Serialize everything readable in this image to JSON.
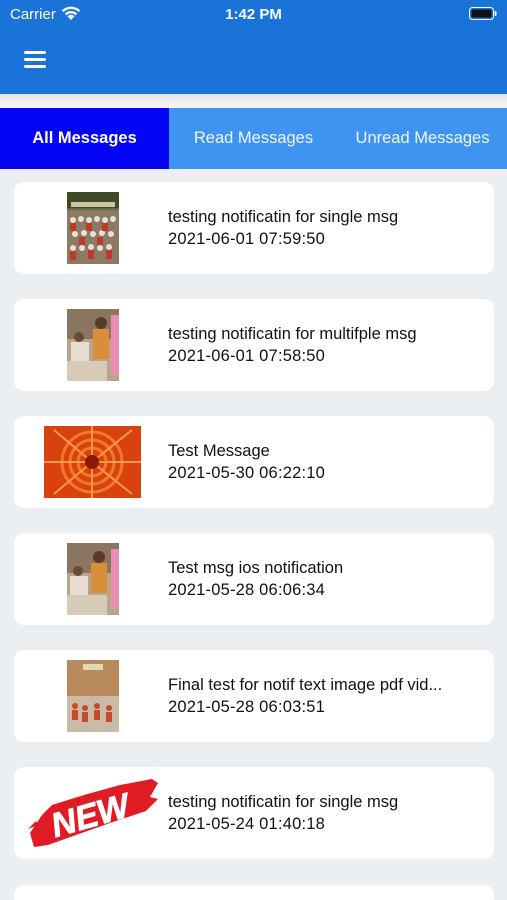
{
  "status_bar": {
    "carrier": "Carrier",
    "time": "1:42 PM"
  },
  "header": {
    "menu_icon": "hamburger-menu-icon",
    "color": "#1a73d9"
  },
  "tabs": [
    {
      "label": "All Messages",
      "active": true
    },
    {
      "label": "Read Messages",
      "active": false
    },
    {
      "label": "Unread Messages",
      "active": false
    }
  ],
  "messages": [
    {
      "title": "testing notificatin for single msg",
      "date": "2021-06-01 07:59:50",
      "thumbnail": "group-photo"
    },
    {
      "title": "testing notificatin for multifple msg",
      "date": "2021-06-01 07:58:50",
      "thumbnail": "ceremony-photo"
    },
    {
      "title": "Test Message",
      "date": "2021-05-30 06:22:10",
      "thumbnail": "orange-flower-photo"
    },
    {
      "title": "Test msg ios notification",
      "date": "2021-05-28 06:06:34",
      "thumbnail": "ceremony-photo"
    },
    {
      "title": "Final test for notif text image pdf vid...",
      "date": "2021-05-28 06:03:51",
      "thumbnail": "document-photo"
    },
    {
      "title": "testing notificatin for single msg",
      "date": "2021-05-24 01:40:18",
      "thumbnail": "new-badge"
    }
  ],
  "colors": {
    "tab_active": "#0505f5",
    "tab_inactive": "#3f94f2",
    "background": "#eceff1"
  },
  "badge_text": "NEW"
}
